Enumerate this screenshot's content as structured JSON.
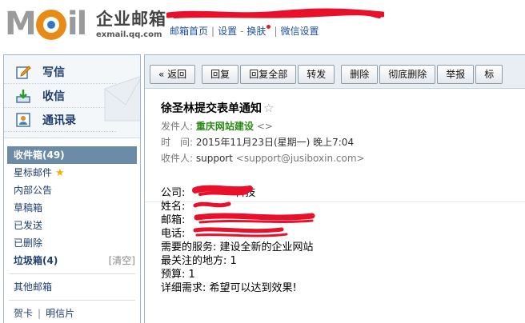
{
  "header": {
    "product_name": "企业邮箱",
    "product_domain": "exmail.qq.com",
    "links": [
      "邮箱首页",
      "设置",
      "换肤",
      "微信设置"
    ]
  },
  "sidebar": {
    "actions": [
      {
        "label": "写信",
        "icon": "compose-icon"
      },
      {
        "label": "收信",
        "icon": "inbox-download-icon"
      },
      {
        "label": "通讯录",
        "icon": "contacts-icon"
      }
    ],
    "folders": {
      "inbox": "收件箱(49)",
      "starred": "星标邮件",
      "announce": "内部公告",
      "drafts": "草稿箱",
      "sent": "已发送",
      "deleted": "已删除",
      "spam": "垃圾箱(4)",
      "spam_clear": "[清空]",
      "other": "其他邮箱",
      "card": "贺卡",
      "postcard": "明信片"
    }
  },
  "toolbar": {
    "back": "« 返回",
    "reply": "回复",
    "reply_all": "回复全部",
    "forward": "转发",
    "delete": "删除",
    "delete_forever": "彻底删除",
    "report": "举报",
    "more": "标"
  },
  "mail": {
    "subject": "徐圣林提交表单通知",
    "from_label": "发件人:",
    "from_name": "重庆网站建设",
    "from_addr": "<>",
    "time_label": "时　间:",
    "time_value": "2015年11月23日(星期一) 晚上7:04",
    "to_label": "收件人:",
    "to_name": "support",
    "to_addr": "<support@jusiboxin.com>",
    "body": {
      "company_label": "公司:",
      "company_value": "科技",
      "name_label": "姓名:",
      "email_label": "邮箱:",
      "phone_label": "电话:",
      "service": "需要的服务: 建设全新的企业网站",
      "concern": "最关注的地方: 1",
      "budget": "预算: 1",
      "detail": "详细需求: 希望可以达到效果!"
    }
  },
  "colors": {
    "link_blue": "#1c50a3",
    "active_folder": "#6c8ba7",
    "sender_green": "#2a8a17",
    "scribble_red": "#e8102a"
  }
}
